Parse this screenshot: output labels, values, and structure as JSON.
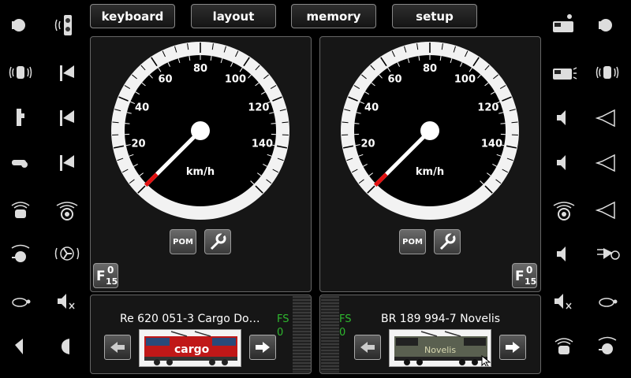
{
  "top_menu": {
    "keyboard": "keyboard",
    "layout": "layout",
    "memory": "memory",
    "setup": "setup"
  },
  "throttles": [
    {
      "speed_unit": "km/h",
      "speed_labels": [
        "20",
        "40",
        "60",
        "80",
        "100",
        "120",
        "140"
      ],
      "pom_label": "POM",
      "function_button": {
        "f": "F",
        "top": "0",
        "bottom": "15"
      },
      "loco_name": "Re 620 051-3 Cargo Do…",
      "fs_label": "FS",
      "fs_value": "0",
      "loco_image_text": "cargo"
    },
    {
      "speed_unit": "km/h",
      "speed_labels": [
        "20",
        "40",
        "60",
        "80",
        "100",
        "120",
        "140"
      ],
      "pom_label": "POM",
      "function_button": {
        "f": "F",
        "top": "0",
        "bottom": "15"
      },
      "loco_name": "BR 189 994-7 Novelis",
      "fs_label": "FS",
      "fs_value": "0",
      "loco_image_text": "Novelis"
    }
  ],
  "icons": {
    "left_outer": [
      "headlight-icon",
      "horn-sound-icon",
      "coupler-icon",
      "whistle-icon",
      "compressor-sound-icon",
      "fan-sound-icon",
      "turtle-icon",
      "cab-light-icon"
    ],
    "left_inner": [
      "signal-sound-icon",
      "buffer-light-icon",
      "buffer-light-icon",
      "buffer-light-icon",
      "brake-sound-icon",
      "ventilator-sound-icon",
      "mute-icon",
      "dim-light-icon"
    ],
    "right_inner": [
      "smoke-loco-icon",
      "loco-sound-icon",
      "speaker-icon",
      "speaker-icon",
      "bell-sound-icon",
      "speaker-icon",
      "mute-icon",
      "compressor-sound-icon"
    ],
    "right_outer": [
      "headlight-icon",
      "horn-sound-icon",
      "horn-icon",
      "horn-icon",
      "horn-icon",
      "fan-shunt-icon",
      "turtle-icon",
      "fan-sound-icon"
    ]
  }
}
